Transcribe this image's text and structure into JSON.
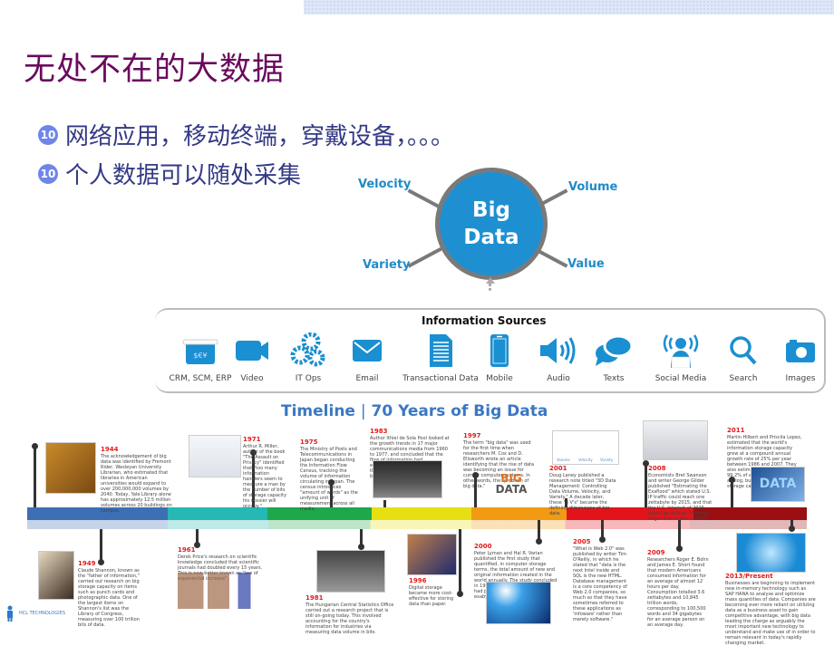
{
  "slide": {
    "title": "无处不在的大数据",
    "bullets": [
      {
        "marker": "10",
        "text": "网络应用，移动终端，穿戴设备，。。。"
      },
      {
        "marker": "10",
        "text": "个人数据可以随处采集"
      }
    ]
  },
  "big_data": {
    "center": [
      "Big",
      "Data"
    ],
    "labels": {
      "top_left": "Velocity",
      "top_right": "Volume",
      "bottom_left": "Variety",
      "bottom_right": "Value"
    },
    "color": "#1e90d2"
  },
  "information_sources": {
    "title": "Information Sources",
    "items": [
      {
        "label": "CRM, SCM, ERP",
        "icon": "money-box-icon"
      },
      {
        "label": "Video",
        "icon": "video-camera-icon"
      },
      {
        "label": "IT Ops",
        "icon": "gears-icon"
      },
      {
        "label": "Email",
        "icon": "envelope-icon"
      },
      {
        "label": "Transactional Data",
        "icon": "document-icon"
      },
      {
        "label": "Mobile",
        "icon": "mobile-phone-icon"
      },
      {
        "label": "Audio",
        "icon": "speaker-icon"
      },
      {
        "label": "Texts",
        "icon": "chat-bubbles-icon"
      },
      {
        "label": "Social Media",
        "icon": "broadcast-person-icon"
      },
      {
        "label": "Search",
        "icon": "magnifier-icon"
      },
      {
        "label": "Images",
        "icon": "camera-icon"
      }
    ]
  },
  "timeline": {
    "title_left": "Timeline",
    "title_right": "70 Years of Big Data",
    "events": [
      {
        "year": "1944",
        "text": "The acknowledgement of big data was identified by Fremont Rider, Wesleyan University Librarian, who estimated that libraries in American universities would expand to over 200,000,000 volumes by 2040. Today, Yale Library alone has approximately 12.5 million volumes across 20 buildings on campus."
      },
      {
        "year": "1949",
        "text": "Claude Shannon, known as the \"father of information,\" carried out research on big storage capacity on items such as punch cards and photographic data. One of the largest items on Shannon's list was the Library of Congress, measuring over 100 trillion bits of data."
      },
      {
        "year": "1961",
        "text": "Derek Price's research on scientific knowledge concluded that scientific journals had doubled every 15 years. This is now better known as \"law of exponential increase\"."
      },
      {
        "year": "1971",
        "text": "Arthur R. Miller, author of the book \"The Assault on Privacy\" identified that \"too many information handlers seem to measure a man by the number of bits of storage capacity his dossier will occupy.\""
      },
      {
        "year": "1975",
        "text": "The Ministry of Posts and Telecommunications in Japan began conducting the Information Flow Census, tracking the volume of information circulating in Japan. The census introduces \"amount of words\" as the unifying unit of measurement across all media."
      },
      {
        "year": "1981",
        "text": "The Hungarian Central Statistics Office carried out a research project that is still on-going today. This involved accounting for the country's information for industries via measuring data volume in bits."
      },
      {
        "year": "1983",
        "text": "Author Ithiel de Sola Pool looked at the growth trends in 17 major communications media from 1960 to 1977, and concluded that the flow of information had exponentially grown by 2.9% throughout that period due to broadcasting and media."
      },
      {
        "year": "1996",
        "text": "Digital storage became more cost-effective for storing data than paper."
      },
      {
        "year": "1997",
        "text": "The term \"big data\" was used for the first time when researchers M. Cox and D. Ellsworth wrote an article identifying that the rise of data was becoming an issue for current computer systems. In other words, the \"problem of big data.\""
      },
      {
        "year": "2000",
        "text": "Peter Lyman and Hal R. Varian published the first study that quantified, in computer storage terms, the total amount of new and original information created in the world annually. The study concluded in 1999, a year in which the world had produced approximately 1.5 exabytes of unique information."
      },
      {
        "year": "2001",
        "text": "Doug Laney published a research note titled \"3D Data Management: Controlling Data Volume, Velocity, and Variety.\" A decade later, these \"3 V's\" became the defining dimensions of big data."
      },
      {
        "year": "2005",
        "text": "\"What is Web 2.0\" was published by writer Tim O'Reilly, in which he stated that \"data is the next Intel inside and SQL is the new HTML. Database management is a core competency of Web 2.0 companies, so much so that they have sometimes referred to these applications as 'infoware' rather than merely software.\""
      },
      {
        "year": "2008",
        "text": "Economists Bret Swanson and writer George Gilder published \"Estimating the Exaflood\" which stated U.S. IP traffic could reach one zettabyte by 2015, and that the U.S. Internet of 2015 would be at least 50 times larger than it was in 2006."
      },
      {
        "year": "2009",
        "text": "Researchers Roger E. Bohn and James E. Short found that modern Americans consumed information for an average of almost 12 hours per day. Consumption totalled 3.6 zettabytes and 10,845 trillion words, corresponding to 100,500 words and 34 gigabytes for an average person on an average day."
      },
      {
        "year": "2011",
        "text": "Martin Hilbert and Priscila Lopez, estimated that the world's information storage capacity grew at a compound annual growth rate of 25% per year between 1986 and 2007. They also estimated that in 1986, 99.2% of all storage capacity was analog, but by 2007, 94% of all storage capacity was digital."
      },
      {
        "year": "2013/Present",
        "text": "Businesses are beginning to implement new in-memory technology such as SAP HANA to analyse and optimize mass quantities of data. Companies are becoming ever more reliant on utilizing data as a business asset to gain competitive advantage, with big data leading the charge as arguably the most important new technology to understand and make use of in order to remain relevant in today's rapidly changing market."
      }
    ],
    "mini_labels": [
      "Volume",
      "Velocity",
      "Variety"
    ],
    "bigdata_word": [
      "BIG",
      "DATA"
    ],
    "data_word": "DATA"
  },
  "footer": {
    "logo_text": "HCL TECHNOLOGIES"
  }
}
